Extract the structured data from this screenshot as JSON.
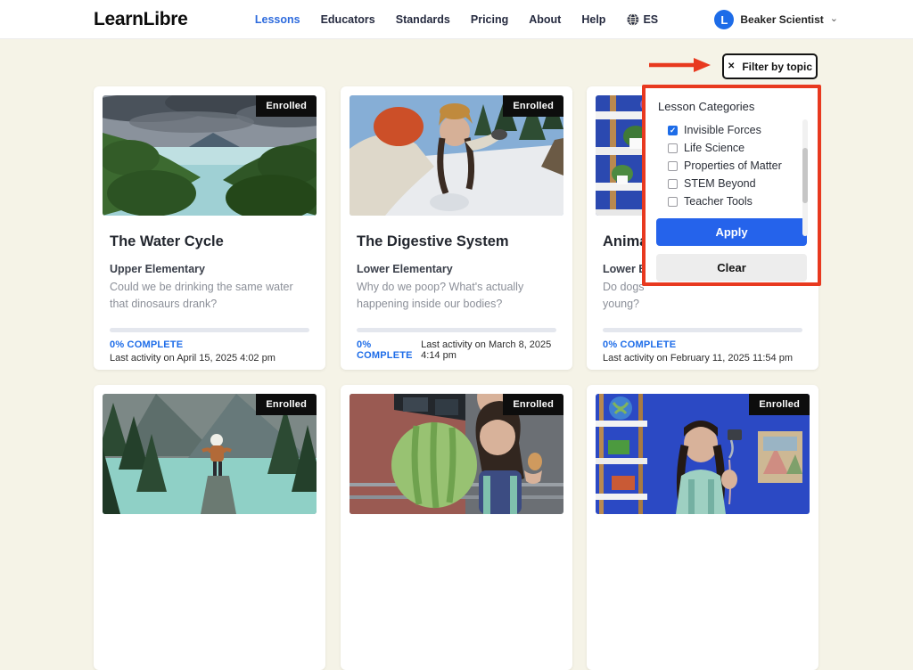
{
  "icons": {
    "close": "✕",
    "chevron_down": "⌄",
    "check": "✓"
  },
  "navbar": {
    "logo": "LearnLibre",
    "items": [
      {
        "label": "Lessons",
        "active": true
      },
      {
        "label": "Educators",
        "active": false
      },
      {
        "label": "Standards",
        "active": false
      },
      {
        "label": "Pricing",
        "active": false
      },
      {
        "label": "About",
        "active": false
      },
      {
        "label": "Help",
        "active": false
      }
    ],
    "language_label": "ES",
    "user_initial": "L",
    "user_name": "Beaker Scientist"
  },
  "filter": {
    "button_label": "Filter by topic",
    "panel_title": "Lesson Categories",
    "options": [
      {
        "label": "Invisible Forces",
        "checked": true
      },
      {
        "label": "Life Science",
        "checked": false
      },
      {
        "label": "Properties of Matter",
        "checked": false
      },
      {
        "label": "STEM Beyond",
        "checked": false
      },
      {
        "label": "Teacher Tools",
        "checked": false
      }
    ],
    "apply_label": "Apply",
    "clear_label": "Clear"
  },
  "cards": [
    {
      "badge": "Enrolled",
      "title": "The Water Cycle",
      "level": "Upper Elementary",
      "description": "Could we be drinking the same water that dinosaurs drank?",
      "progress_label": "0% COMPLETE",
      "activity": "Last activity on April 15, 2025 4:02 pm"
    },
    {
      "badge": "Enrolled",
      "title": "The Digestive System",
      "level": "Lower Elementary",
      "description": "Why do we poop? What's actually happening inside our bodies?",
      "progress_label": "0% COMPLETE",
      "activity": "Last activity on March 8, 2025 4:14 pm"
    },
    {
      "badge": "Enrolled",
      "title": "Animal",
      "level": "Lower El",
      "description_line1": "Do dogs",
      "description_line2": "young?",
      "progress_label": "0% COMPLETE",
      "activity": "Last activity on February 11, 2025 11:54 pm"
    }
  ],
  "bottom_cards": [
    {
      "badge": "Enrolled"
    },
    {
      "badge": "Enrolled"
    },
    {
      "badge": "Enrolled"
    }
  ],
  "colors": {
    "accent_blue": "#1d6ce8",
    "apply_blue": "#2563eb",
    "alert_red": "#e8391f",
    "badge_black": "#0d0d0d",
    "page_bg": "#f5f3e7"
  }
}
